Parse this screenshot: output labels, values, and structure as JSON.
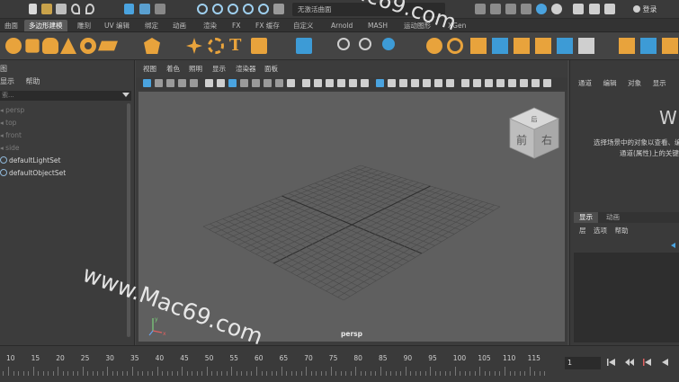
{
  "topbar": {
    "status_field": "无激活曲面",
    "login_label": "登录",
    "icons": [
      "new-file-icon",
      "open-file-icon",
      "save-icon",
      "undo-icon",
      "redo-icon",
      "select-tool-icon",
      "lasso-tool-icon",
      "paint-select-icon",
      "snap-grid-icon",
      "snap-curve-icon",
      "snap-point-icon",
      "snap-view-icon",
      "snap-surface-icon",
      "history-icon",
      "render-icon",
      "ipr-icon",
      "render-settings-icon",
      "hypershade-icon",
      "panel-layout-icon",
      "ui-elements-icon",
      "login-icon"
    ]
  },
  "shelf_tabs": [
    {
      "label": "曲面",
      "active": false
    },
    {
      "label": "多边形建模",
      "active": true
    },
    {
      "label": "雕刻",
      "active": false
    },
    {
      "label": "UV 编辑",
      "active": false
    },
    {
      "label": "绑定",
      "active": false
    },
    {
      "label": "动画",
      "active": false
    },
    {
      "label": "渲染",
      "active": false
    },
    {
      "label": "FX",
      "active": false
    },
    {
      "label": "FX 缓存",
      "active": false
    },
    {
      "label": "自定义",
      "active": false
    },
    {
      "label": "Arnold",
      "active": false
    },
    {
      "label": "MASH",
      "active": false
    },
    {
      "label": "运动图形",
      "active": false
    },
    {
      "label": "XGen",
      "active": false
    }
  ],
  "shelf_icons": [
    "poly-sphere-icon",
    "poly-cube-icon",
    "poly-cylinder-icon",
    "poly-cone-icon",
    "poly-torus-icon",
    "poly-plane-icon",
    "platonic-icon",
    "super-shape-icon",
    "sweep-mesh-icon",
    "type-tool-icon",
    "svg-tool-icon",
    "uv-editor-icon",
    "combine-icon",
    "separate-icon",
    "smooth-icon",
    "boolean-icon",
    "mirror-icon",
    "extrude-icon",
    "bevel-icon",
    "bridge-icon"
  ],
  "outliner": {
    "title": "图",
    "menu": [
      "显示",
      "帮助"
    ],
    "search_placeholder": "索...",
    "items": [
      {
        "label": "persp",
        "dim": true
      },
      {
        "label": "top",
        "dim": true
      },
      {
        "label": "front",
        "dim": true
      },
      {
        "label": "side",
        "dim": true
      },
      {
        "label": "defaultLightSet",
        "dim": false
      },
      {
        "label": "defaultObjectSet",
        "dim": false
      }
    ]
  },
  "viewport": {
    "menu": [
      "视图",
      "着色",
      "照明",
      "显示",
      "渲染器",
      "面板"
    ],
    "camera_label": "persp",
    "view_cube": {
      "top": "后",
      "front": "前",
      "right": "右"
    },
    "axis": {
      "y": "y",
      "x": "x"
    }
  },
  "right_panel": {
    "menu": [
      "通道",
      "编辑",
      "对象",
      "显示"
    ],
    "big_letter": "W",
    "message_line1": "选择场景中的对象以查看、编",
    "message_line2": "通道(属性)上的关键帧",
    "layer_tabs": [
      "显示",
      "动画"
    ],
    "layer_menu": [
      "层",
      "选项",
      "帮助"
    ]
  },
  "timeline": {
    "ticks": [
      10,
      15,
      20,
      25,
      30,
      35,
      40,
      45,
      50,
      55,
      60,
      65,
      70,
      75,
      80,
      85,
      90,
      95,
      100,
      105,
      110,
      115
    ],
    "current_frame": "1"
  },
  "watermarks": [
    "www.Mac69.com",
    "ac69.com"
  ],
  "colors": {
    "accent_blue": "#4aa3df",
    "shelf_orange": "#e8a33c",
    "shelf_blue": "#3d9bd6",
    "grid_line": "#4a4a4a"
  }
}
